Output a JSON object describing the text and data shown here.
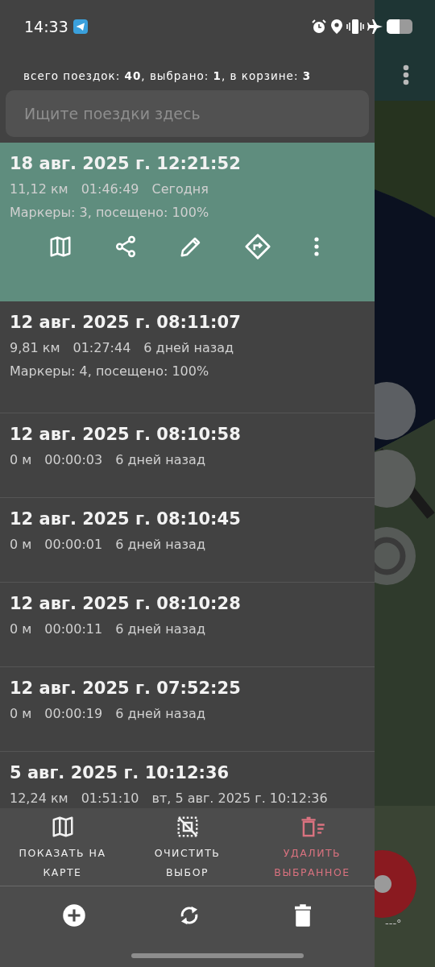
{
  "status_bar": {
    "time": "14:33"
  },
  "summary": "всего поездок: **40**, выбрано: **1**, в корзине: **3**",
  "search": {
    "placeholder": "Ищите поездки здесь"
  },
  "trips": [
    {
      "title": "18 авг. 2025 г. 12:21:52",
      "distance": "11,12 км",
      "duration": "01:46:49",
      "when": "Сегодня",
      "markers": "Маркеры: 3, посещено: 100%",
      "selected": true
    },
    {
      "title": "12 авг. 2025 г. 08:11:07",
      "distance": "9,81 км",
      "duration": "01:27:44",
      "when": "6 дней назад",
      "markers": "Маркеры: 4, посещено: 100%",
      "selected": false
    },
    {
      "title": "12 авг. 2025 г. 08:10:58",
      "distance": "0 м",
      "duration": "00:00:03",
      "when": "6 дней назад",
      "selected": false
    },
    {
      "title": "12 авг. 2025 г. 08:10:45",
      "distance": "0 м",
      "duration": "00:00:01",
      "when": "6 дней назад",
      "selected": false
    },
    {
      "title": "12 авг. 2025 г. 08:10:28",
      "distance": "0 м",
      "duration": "00:00:11",
      "when": "6 дней назад",
      "selected": false
    },
    {
      "title": "12 авг. 2025 г. 07:52:25",
      "distance": "0 м",
      "duration": "00:00:19",
      "when": "6 дней назад",
      "selected": false
    },
    {
      "title": "5 авг. 2025 г. 10:12:36",
      "distance": "12,24 км",
      "duration": "01:51:10",
      "when": "вт, 5 авг. 2025 г. 10:12:36",
      "selected": false
    }
  ],
  "actions": [
    {
      "kind": "map",
      "label": "ПОКАЗАТЬ НА КАРТЕ",
      "danger": false
    },
    {
      "kind": "clear",
      "label": "ОЧИСТИТЬ ВЫБОР",
      "danger": false
    },
    {
      "kind": "delete",
      "label": "УДАЛИТЬ ВЫБРАННОЕ",
      "danger": true
    }
  ],
  "map_overlay": {
    "heading": "---°"
  }
}
